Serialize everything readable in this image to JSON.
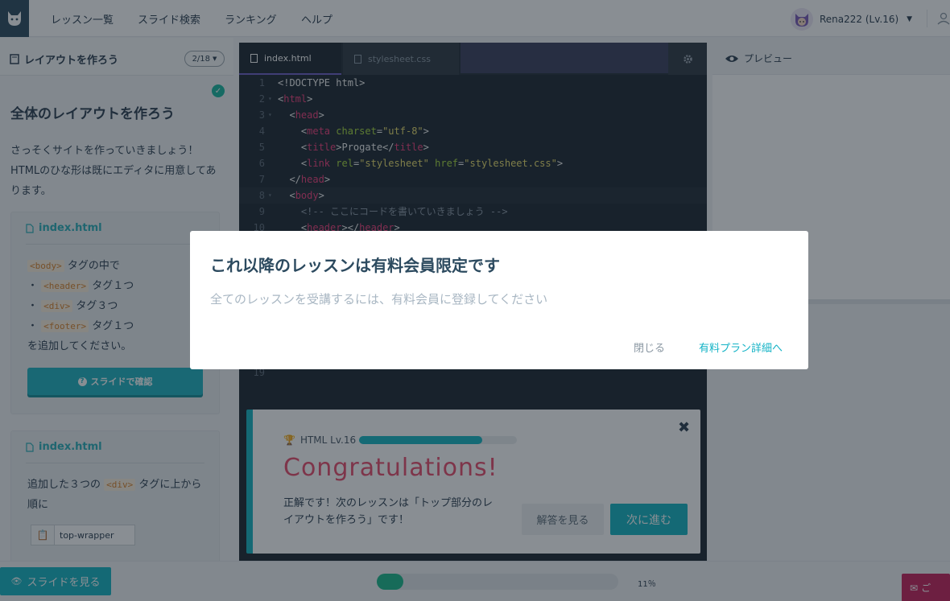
{
  "nav": {
    "links": [
      "レッスン一覧",
      "スライド検索",
      "ランキング",
      "ヘルプ"
    ],
    "user": "Rena222 (Lv.16)"
  },
  "left": {
    "header_title": "レイアウトを作ろう",
    "pager": "2/18",
    "lesson_title": "全体のレイアウトを作ろう",
    "lesson_desc": "さっそくサイトを作っていきましょう！HTMLのひな形は既にエディタに用意してあります。",
    "card1": {
      "file": "index.html",
      "tag_body": "<body>",
      "text_body": "タグの中で",
      "bullet": "・",
      "tag_header": "<header>",
      "text_header": "タグ１つ",
      "tag_div": "<div>",
      "text_div": "タグ３つ",
      "tag_footer": "<footer>",
      "text_footer": "タグ１つ",
      "text_end": "を追加してください。",
      "button": "スライドで確認"
    },
    "card2": {
      "file": "index.html",
      "text_pre": "追加した３つの",
      "tag_div": "<div>",
      "text_post": "タグに上から順に",
      "input_value": "top-wrapper"
    }
  },
  "editor": {
    "tabs": [
      "index.html",
      "stylesheet.css"
    ],
    "lines": [
      {
        "n": "1",
        "fold": ""
      },
      {
        "n": "2",
        "fold": "▾"
      },
      {
        "n": "3",
        "fold": "▾"
      },
      {
        "n": "4",
        "fold": ""
      },
      {
        "n": "5",
        "fold": ""
      },
      {
        "n": "6",
        "fold": ""
      },
      {
        "n": "7",
        "fold": ""
      },
      {
        "n": "8",
        "fold": "▾"
      },
      {
        "n": "9",
        "fold": ""
      },
      {
        "n": "10",
        "fold": ""
      }
    ],
    "line19": "19"
  },
  "preview": {
    "label": "プレビュー"
  },
  "modal": {
    "title": "これ以降のレッスンは有料会員限定です",
    "message": "全てのレッスンを受講するには、有料会員に登録してください",
    "close": "閉じる",
    "plan": "有料プラン詳細へ"
  },
  "congrats": {
    "level": "HTML Lv.16",
    "level_progress": 0.78,
    "title": "Congratulations!",
    "message": "正解です！次のレッスンは「トップ部分のレイアウトを作ろう」です！",
    "answer_button": "解答を見る",
    "next_button": "次に進む"
  },
  "bottom": {
    "slides_button": "スライドを見る",
    "progress_label": "11％",
    "progress_value": 0.11,
    "help_button": "ご"
  },
  "colors": {
    "accent": "#15b5c2",
    "pink": "#e84c6c",
    "green": "#1bb98a"
  }
}
